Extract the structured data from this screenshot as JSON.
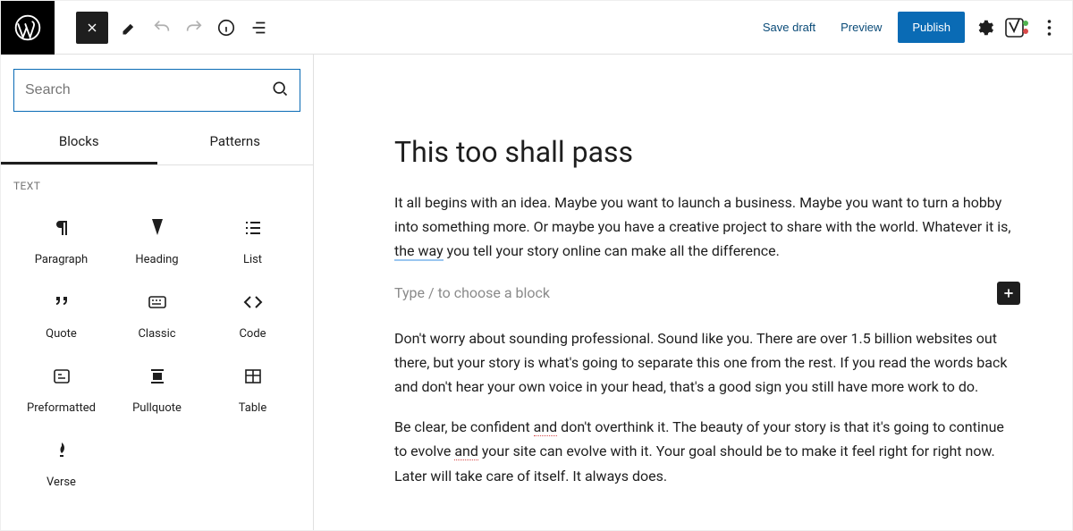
{
  "toolbar": {
    "save_draft": "Save draft",
    "preview": "Preview",
    "publish": "Publish"
  },
  "inserter": {
    "search_placeholder": "Search",
    "tabs": {
      "blocks": "Blocks",
      "patterns": "Patterns"
    },
    "section_text": "TEXT",
    "blocks": {
      "paragraph": "Paragraph",
      "heading": "Heading",
      "list": "List",
      "quote": "Quote",
      "classic": "Classic",
      "code": "Code",
      "preformatted": "Preformatted",
      "pullquote": "Pullquote",
      "table": "Table",
      "verse": "Verse"
    }
  },
  "post": {
    "title": "This too shall pass",
    "p1_a": "It all begins with an idea. Maybe you want to launch a business. Maybe you want to turn a hobby into something more. Or maybe you have a creative project to share with the world. Whatever it is, ",
    "p1_link": "the way",
    "p1_b": " you tell your story online can make all the difference.",
    "placeholder": "Type / to choose a block",
    "p2": "Don't worry about sounding professional. Sound like you. There are over 1.5 billion websites out there, but your story is what's going to separate this one from the rest. If you read the words back and don't hear your own voice in your head, that's a good sign you still have more work to do.",
    "p3_a": "Be clear, be confident ",
    "p3_sp1": "and",
    "p3_b": " don't overthink it. The beauty of your story is that it's going to continue to evolve ",
    "p3_sp2": "and",
    "p3_c": " your site can evolve with it. Your goal should be to make it feel right for right now. Later will take care of itself. It always does."
  }
}
